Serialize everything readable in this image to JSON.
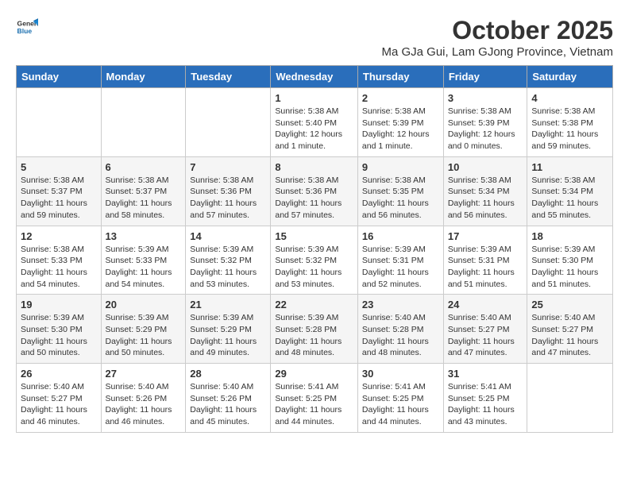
{
  "header": {
    "logo_general": "General",
    "logo_blue": "Blue",
    "month_title": "October 2025",
    "subtitle": "Ma GJa Gui, Lam GJong Province, Vietnam"
  },
  "weekdays": [
    "Sunday",
    "Monday",
    "Tuesday",
    "Wednesday",
    "Thursday",
    "Friday",
    "Saturday"
  ],
  "weeks": [
    [
      {
        "day": "",
        "info": ""
      },
      {
        "day": "",
        "info": ""
      },
      {
        "day": "",
        "info": ""
      },
      {
        "day": "1",
        "info": "Sunrise: 5:38 AM\nSunset: 5:40 PM\nDaylight: 12 hours\nand 1 minute."
      },
      {
        "day": "2",
        "info": "Sunrise: 5:38 AM\nSunset: 5:39 PM\nDaylight: 12 hours\nand 1 minute."
      },
      {
        "day": "3",
        "info": "Sunrise: 5:38 AM\nSunset: 5:39 PM\nDaylight: 12 hours\nand 0 minutes."
      },
      {
        "day": "4",
        "info": "Sunrise: 5:38 AM\nSunset: 5:38 PM\nDaylight: 11 hours\nand 59 minutes."
      }
    ],
    [
      {
        "day": "5",
        "info": "Sunrise: 5:38 AM\nSunset: 5:37 PM\nDaylight: 11 hours\nand 59 minutes."
      },
      {
        "day": "6",
        "info": "Sunrise: 5:38 AM\nSunset: 5:37 PM\nDaylight: 11 hours\nand 58 minutes."
      },
      {
        "day": "7",
        "info": "Sunrise: 5:38 AM\nSunset: 5:36 PM\nDaylight: 11 hours\nand 57 minutes."
      },
      {
        "day": "8",
        "info": "Sunrise: 5:38 AM\nSunset: 5:36 PM\nDaylight: 11 hours\nand 57 minutes."
      },
      {
        "day": "9",
        "info": "Sunrise: 5:38 AM\nSunset: 5:35 PM\nDaylight: 11 hours\nand 56 minutes."
      },
      {
        "day": "10",
        "info": "Sunrise: 5:38 AM\nSunset: 5:34 PM\nDaylight: 11 hours\nand 56 minutes."
      },
      {
        "day": "11",
        "info": "Sunrise: 5:38 AM\nSunset: 5:34 PM\nDaylight: 11 hours\nand 55 minutes."
      }
    ],
    [
      {
        "day": "12",
        "info": "Sunrise: 5:38 AM\nSunset: 5:33 PM\nDaylight: 11 hours\nand 54 minutes."
      },
      {
        "day": "13",
        "info": "Sunrise: 5:39 AM\nSunset: 5:33 PM\nDaylight: 11 hours\nand 54 minutes."
      },
      {
        "day": "14",
        "info": "Sunrise: 5:39 AM\nSunset: 5:32 PM\nDaylight: 11 hours\nand 53 minutes."
      },
      {
        "day": "15",
        "info": "Sunrise: 5:39 AM\nSunset: 5:32 PM\nDaylight: 11 hours\nand 53 minutes."
      },
      {
        "day": "16",
        "info": "Sunrise: 5:39 AM\nSunset: 5:31 PM\nDaylight: 11 hours\nand 52 minutes."
      },
      {
        "day": "17",
        "info": "Sunrise: 5:39 AM\nSunset: 5:31 PM\nDaylight: 11 hours\nand 51 minutes."
      },
      {
        "day": "18",
        "info": "Sunrise: 5:39 AM\nSunset: 5:30 PM\nDaylight: 11 hours\nand 51 minutes."
      }
    ],
    [
      {
        "day": "19",
        "info": "Sunrise: 5:39 AM\nSunset: 5:30 PM\nDaylight: 11 hours\nand 50 minutes."
      },
      {
        "day": "20",
        "info": "Sunrise: 5:39 AM\nSunset: 5:29 PM\nDaylight: 11 hours\nand 50 minutes."
      },
      {
        "day": "21",
        "info": "Sunrise: 5:39 AM\nSunset: 5:29 PM\nDaylight: 11 hours\nand 49 minutes."
      },
      {
        "day": "22",
        "info": "Sunrise: 5:39 AM\nSunset: 5:28 PM\nDaylight: 11 hours\nand 48 minutes."
      },
      {
        "day": "23",
        "info": "Sunrise: 5:40 AM\nSunset: 5:28 PM\nDaylight: 11 hours\nand 48 minutes."
      },
      {
        "day": "24",
        "info": "Sunrise: 5:40 AM\nSunset: 5:27 PM\nDaylight: 11 hours\nand 47 minutes."
      },
      {
        "day": "25",
        "info": "Sunrise: 5:40 AM\nSunset: 5:27 PM\nDaylight: 11 hours\nand 47 minutes."
      }
    ],
    [
      {
        "day": "26",
        "info": "Sunrise: 5:40 AM\nSunset: 5:27 PM\nDaylight: 11 hours\nand 46 minutes."
      },
      {
        "day": "27",
        "info": "Sunrise: 5:40 AM\nSunset: 5:26 PM\nDaylight: 11 hours\nand 46 minutes."
      },
      {
        "day": "28",
        "info": "Sunrise: 5:40 AM\nSunset: 5:26 PM\nDaylight: 11 hours\nand 45 minutes."
      },
      {
        "day": "29",
        "info": "Sunrise: 5:41 AM\nSunset: 5:25 PM\nDaylight: 11 hours\nand 44 minutes."
      },
      {
        "day": "30",
        "info": "Sunrise: 5:41 AM\nSunset: 5:25 PM\nDaylight: 11 hours\nand 44 minutes."
      },
      {
        "day": "31",
        "info": "Sunrise: 5:41 AM\nSunset: 5:25 PM\nDaylight: 11 hours\nand 43 minutes."
      },
      {
        "day": "",
        "info": ""
      }
    ]
  ]
}
